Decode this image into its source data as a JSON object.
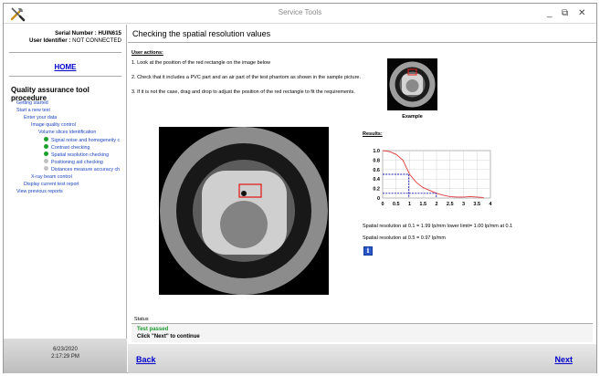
{
  "window": {
    "title": "Service Tools",
    "icons": {
      "app": "tools-icon",
      "minimize": "minimize-icon",
      "restore": "restore-icon",
      "close": "close-icon"
    }
  },
  "sidebar": {
    "serial_label": "Serial Number :",
    "serial_value": "HUIN615",
    "user_label": "User Identifier :",
    "user_value": "NOT CONNECTED",
    "home": "HOME",
    "procedure_title": "Quality assurance tool procedure",
    "nav": [
      {
        "label": "Getting started",
        "level": 0,
        "dot": ""
      },
      {
        "label": "Start a new test",
        "level": 0,
        "dot": ""
      },
      {
        "label": "Enter your data",
        "level": 1,
        "dot": ""
      },
      {
        "label": "Image quality control",
        "level": 2,
        "dot": ""
      },
      {
        "label": "Volume slices identification",
        "level": 3,
        "dot": ""
      },
      {
        "label": "Signal noise and homogeneity c",
        "level": 4,
        "dot": "green"
      },
      {
        "label": "Contrast checking",
        "level": 4,
        "dot": "green"
      },
      {
        "label": "Spatial resolution checking",
        "level": 4,
        "dot": "green"
      },
      {
        "label": "Positioning aid checking",
        "level": 4,
        "dot": "grey"
      },
      {
        "label": "Distances measure accuracy ch",
        "level": 4,
        "dot": "grey"
      },
      {
        "label": "X-ray beam control",
        "level": 2,
        "dot": ""
      },
      {
        "label": "Display current test report",
        "level": 1,
        "dot": ""
      },
      {
        "label": "View previous reports",
        "level": 0,
        "dot": ""
      }
    ],
    "date": "6/23/2020",
    "time": "2:17:29 PM"
  },
  "main": {
    "title": "Checking the spatial resolution values",
    "user_actions_label": "User actions:",
    "instructions": [
      "1. Look at the position of the red rectangle on the image below",
      "2. Check that it includes a PVC part and an air part of the test phantom as shown in the sample picture.",
      "3. If it is not the case, drag and drop to adjust the position of the red rectangle to fit the requirements."
    ],
    "example_label": "Example",
    "results_label": "Results:",
    "result_line_1": "Spatial resolution at 0.1 = 1.99 lp/mm  lower limit= 1.00 lp/mm at 0.1",
    "result_line_2": "Spatial resolution at 0.5 = 0.97 lp/mm",
    "info": "i",
    "status_label": "Status",
    "status_pass": "Test passed",
    "status_next": "Click \"Next\" to continue",
    "back": "Back",
    "next": "Next",
    "colors": {
      "link": "#0000cc",
      "pass": "#1a9a2b",
      "roi": "#e02020",
      "curve": "#e0393e",
      "guide": "#1a1ab0"
    }
  },
  "chart_data": {
    "type": "line",
    "x": [
      0,
      0.25,
      0.5,
      0.75,
      1,
      1.25,
      1.5,
      1.75,
      2,
      2.25,
      2.5,
      2.75,
      3,
      3.25,
      3.5,
      3.75
    ],
    "series": [
      {
        "values": [
          1,
          0.98,
          0.92,
          0.8,
          0.5,
          0.33,
          0.22,
          0.16,
          0.1,
          0.06,
          0.03,
          0.02,
          0.02,
          0.03,
          0.02,
          0.01
        ]
      }
    ],
    "guides": [
      {
        "y": 0.5,
        "x": 0.97
      },
      {
        "y": 0.1,
        "x": 1.99
      }
    ],
    "xticks": [
      "0",
      "0.5",
      "1",
      "1.5",
      "2",
      "2.5",
      "3",
      "3.5",
      "4"
    ],
    "yticks": [
      "0",
      "0.2",
      "0.4",
      "0.6",
      "0.8",
      "1.0"
    ],
    "xlim": [
      0,
      4
    ],
    "ylim": [
      0,
      1
    ],
    "grid": true
  }
}
